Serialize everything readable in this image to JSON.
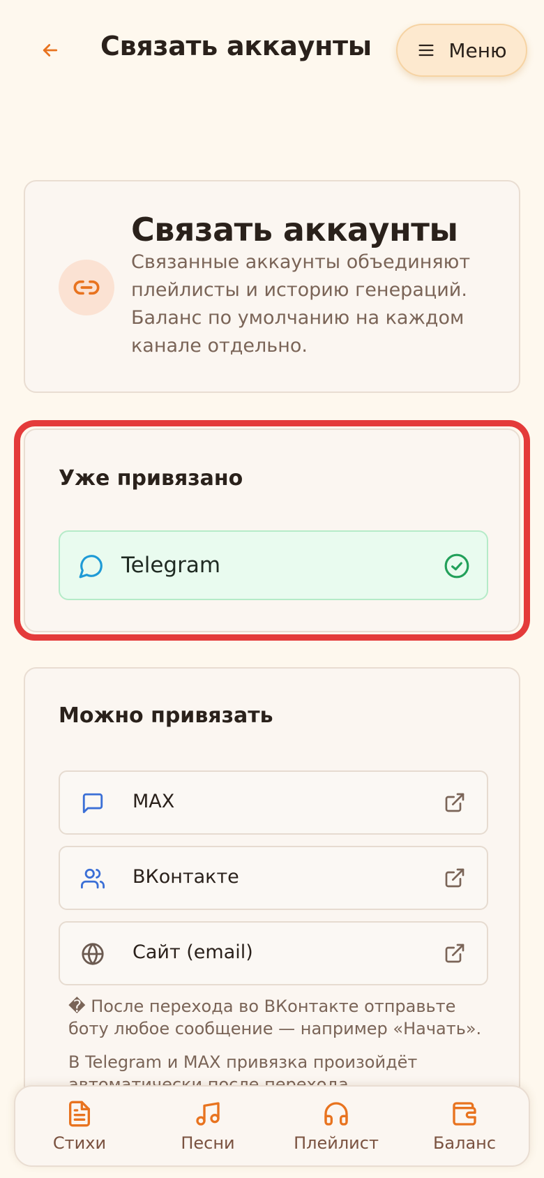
{
  "header": {
    "title": "Связать аккаунты",
    "menu_label": "Меню"
  },
  "intro": {
    "title": "Связать аккаунты",
    "description": "Связанные аккаунты объединяют плейлисты и историю генераций. Баланс по умолчанию на каждом канале отдельно."
  },
  "linked": {
    "title": "Уже привязано",
    "items": [
      {
        "label": "Telegram",
        "icon": "chat-bubble-icon",
        "status": "check-circle-icon"
      }
    ]
  },
  "available": {
    "title": "Можно привязать",
    "items": [
      {
        "label": "MAX",
        "icon": "message-square-icon"
      },
      {
        "label": "ВКонтакте",
        "icon": "users-icon"
      },
      {
        "label": "Сайт (email)",
        "icon": "globe-icon"
      }
    ],
    "note1": "� После перехода во ВКонтакте отправьте боту любое сообщение — например «Начать».",
    "note2": "В Telegram и MAX привязка произойдёт автоматически после перехода."
  },
  "bottom_nav": [
    {
      "label": "Стихи",
      "icon": "document-icon"
    },
    {
      "label": "Песни",
      "icon": "music-icon"
    },
    {
      "label": "Плейлист",
      "icon": "headphones-icon"
    },
    {
      "label": "Баланс",
      "icon": "wallet-icon"
    }
  ],
  "colors": {
    "background": "#fef8ee",
    "accent": "#e8731f",
    "highlight_frame": "#e43b3a",
    "linked_bg": "#e9fbef",
    "success": "#22a05a"
  }
}
